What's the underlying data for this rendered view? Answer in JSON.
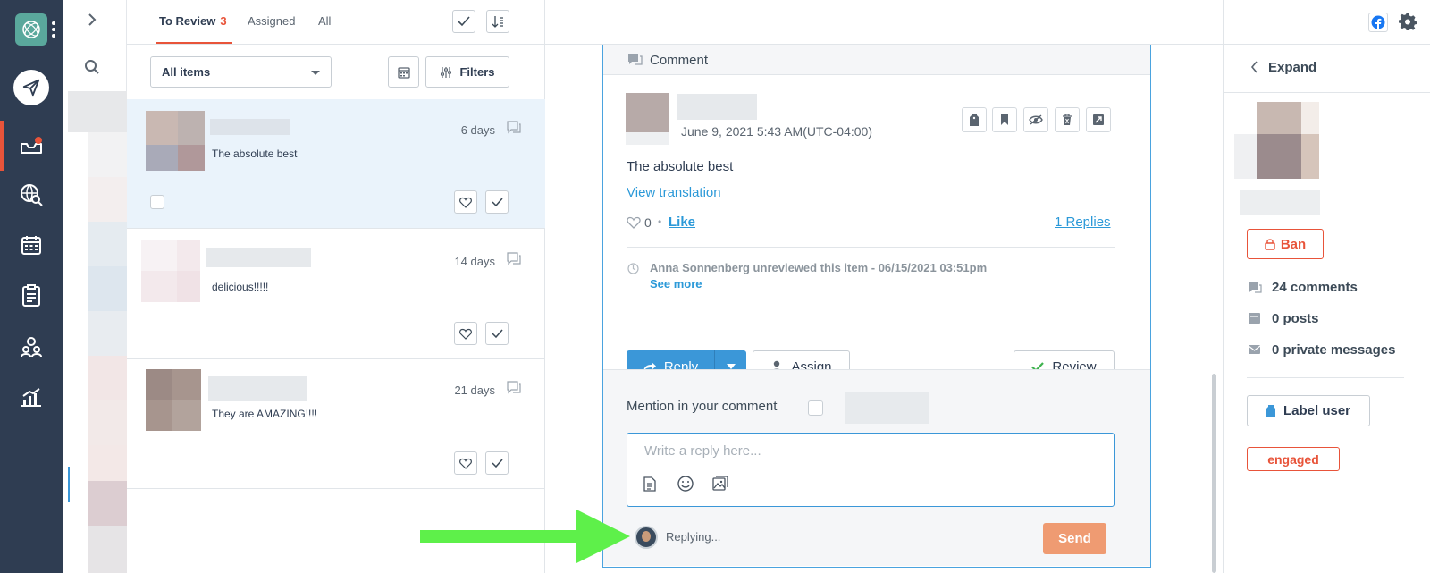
{
  "tabs": {
    "to_review": "To Review",
    "to_review_count": "3",
    "assigned": "Assigned",
    "all": "All"
  },
  "filters": {
    "select_value": "All items",
    "filters_label": "Filters"
  },
  "items": [
    {
      "text": "The absolute best",
      "age": "6 days",
      "selected": true
    },
    {
      "text": "delicious!!!!!",
      "age": "14 days",
      "selected": false
    },
    {
      "text": "They are AMAZING!!!!",
      "age": "21 days",
      "selected": false
    }
  ],
  "comment": {
    "header": "Comment",
    "date": "June 9, 2021 5:43 AM(UTC-04:00)",
    "body": "The absolute best",
    "view_translation": "View translation",
    "like_count": "0",
    "bullet": "•",
    "like": "Like",
    "replies": "1 Replies",
    "history_text": "Anna Sonnenberg unreviewed this item - 06/15/2021 03:51pm",
    "see_more": "See more",
    "reply_label": "Reply",
    "assign_label": "Assign",
    "review_label": "Review"
  },
  "compose": {
    "mention_label": "Mention in your comment",
    "placeholder": "Write a reply here...",
    "replying": "Replying...",
    "send": "Send"
  },
  "profile": {
    "expand": "Expand",
    "ban": "Ban",
    "comments": "24 comments",
    "posts": "0 posts",
    "private_messages": "0 private messages",
    "label_user": "Label user",
    "tag": "engaged"
  },
  "colors": {
    "nav_bg": "#2f3d52",
    "accent_orange": "#e8543a",
    "accent_blue": "#3b97d8",
    "send_bg": "#ef9b72",
    "selected_row": "#eaf3fb",
    "annotation_arrow": "#5ef04a"
  }
}
